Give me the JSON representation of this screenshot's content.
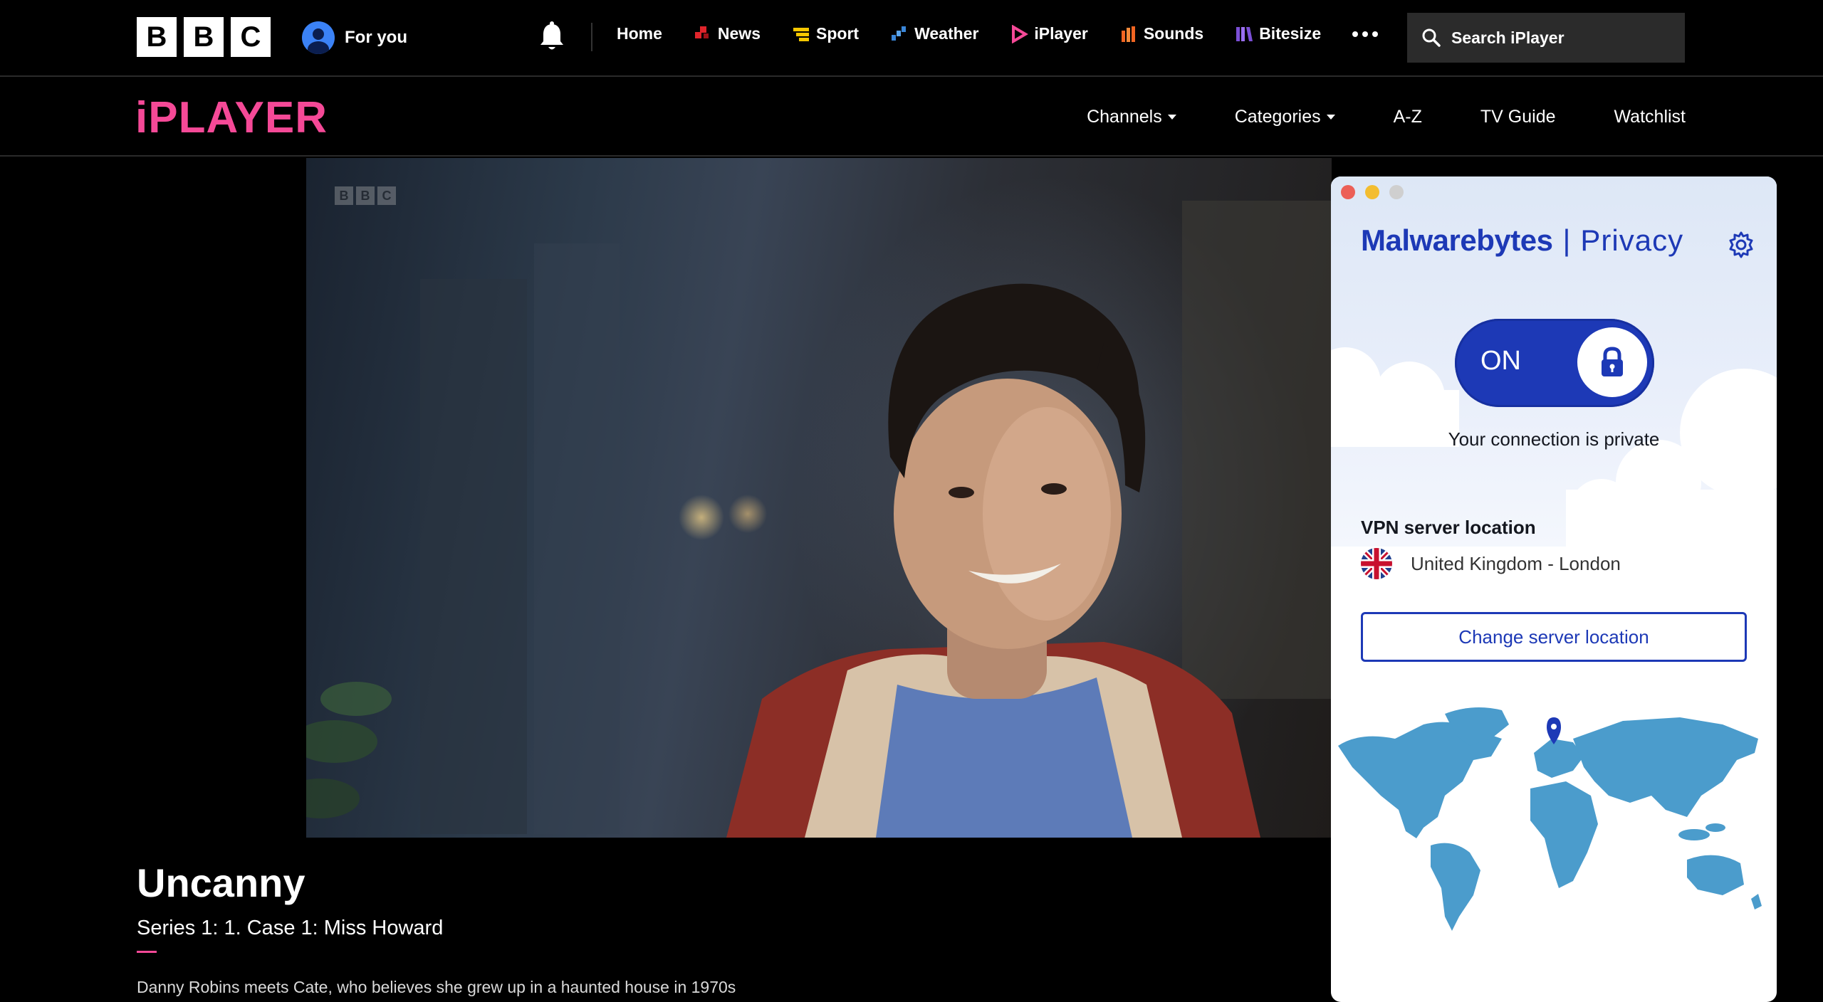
{
  "bbc_nav": {
    "logo_letters": [
      "B",
      "B",
      "C"
    ],
    "for_you": "For you",
    "links": [
      {
        "label": "Home",
        "icon": "none"
      },
      {
        "label": "News",
        "icon": "news-icon",
        "color": "#e0242b"
      },
      {
        "label": "Sport",
        "icon": "sport-icon",
        "color": "#f6c700"
      },
      {
        "label": "Weather",
        "icon": "weather-icon",
        "color": "#3a86d8"
      },
      {
        "label": "iPlayer",
        "icon": "iplayer-icon",
        "color": "#f54997"
      },
      {
        "label": "Sounds",
        "icon": "sounds-icon",
        "color": "#f26522"
      },
      {
        "label": "Bitesize",
        "icon": "bitesize-icon",
        "color": "#7b4fd6"
      }
    ],
    "search_placeholder": "Search iPlayer"
  },
  "iplayer_nav": {
    "logo": "iPLAYER",
    "logo_color": "#f54997",
    "links": [
      "Channels",
      "Categories",
      "A-Z",
      "TV Guide",
      "Watchlist"
    ]
  },
  "video": {
    "watermark": [
      "B",
      "B",
      "C"
    ]
  },
  "programme": {
    "title": "Uncanny",
    "subtitle": "Series 1: 1. Case 1: Miss Howard",
    "description": "Danny Robins meets Cate, who believes she grew up in a haunted house in 1970s"
  },
  "vpn": {
    "brand": "Malwarebytes",
    "separator": "|",
    "product": "Privacy",
    "toggle_label": "ON",
    "status": "Your connection is private",
    "server_heading": "VPN server location",
    "server_location": "United Kingdom - London",
    "change_button": "Change server location",
    "accent_color": "#1d39b6",
    "map_color": "#4b9ccc"
  }
}
